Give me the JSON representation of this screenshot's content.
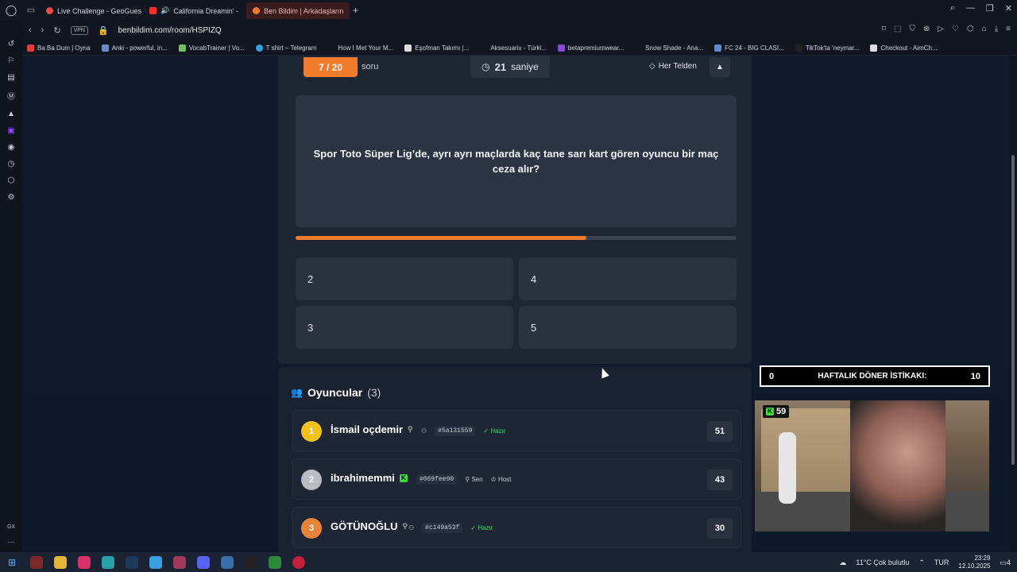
{
  "browser": {
    "tabs": [
      {
        "title": "Live Challenge - GeoGues",
        "color": "#e94a4a"
      },
      {
        "title": "California Dreamin' -",
        "color": "#ff2f2f"
      },
      {
        "title": "Ben Bildim | Arkadaşların",
        "color": "#f07b2a"
      }
    ],
    "url": "benbildim.com/room/HSPIZQ",
    "vpn_label": "VPN"
  },
  "bookmarks": [
    {
      "label": "Ba Ba Dum | Oyna",
      "color": "#e23b3b"
    },
    {
      "label": "Anki - powerful, in...",
      "color": "#6d8cc7"
    },
    {
      "label": "VocabTrainer | Vo...",
      "color": "#6ec05a"
    },
    {
      "label": "T shirt – Telegram",
      "color": "#3aa0e0"
    },
    {
      "label": "How I Met Your M...",
      "color": "#121620"
    },
    {
      "label": "Eşofman Takımı |...",
      "color": "#dddddd"
    },
    {
      "label": "Aksesuarix - Türki...",
      "color": "#121620"
    },
    {
      "label": "betapremiumwear...",
      "color": "#8a4ad8"
    },
    {
      "label": "Snow Shade - Ana...",
      "color": "#121620"
    },
    {
      "label": "FC 24 - BIG CLASI...",
      "color": "#5a8ad0"
    },
    {
      "label": "TikTok'ta 'neymar...",
      "color": "#222222"
    },
    {
      "label": "Checkout - AimCh...",
      "color": "#dddddd"
    }
  ],
  "quiz": {
    "question_counter": "7 / 20",
    "question_unit": "soru",
    "timer_value": "21",
    "timer_unit": "saniye",
    "category": "Her Telden",
    "question_text": "Spor Toto Süper Lig’de, ayrı ayrı maçlarda kaç tane sarı kart gören oyuncu bir maç ceza alır?",
    "progress_fraction": 0.66,
    "answers": [
      "2",
      "4",
      "3",
      "5"
    ]
  },
  "players_section": {
    "title": "Oyuncular",
    "count": "(3)",
    "players": [
      {
        "rank": "1",
        "name": "İsmail oçdemir",
        "tag": "#5a131559",
        "status": "Hazır",
        "score": "51",
        "rank_color": "#f2c21b"
      },
      {
        "rank": "2",
        "name": "ibrahimemmi",
        "tag": "#069fee90",
        "you": "Sen",
        "host": "Host",
        "score": "43",
        "rank_color": "#b9bcc2"
      },
      {
        "rank": "3",
        "name": "GÖTÜNOĞLU",
        "tag": "#c149a53f",
        "status": "Hazır",
        "score": "30",
        "rank_color": "#e8843a"
      }
    ]
  },
  "overlay": {
    "left_value": "0",
    "title": "HAFTALIK DÖNER İSTİKAKI:",
    "right_value": "10",
    "cam_badge": "59"
  },
  "taskbar": {
    "weather": "11°C  Çok bulutlu",
    "lang": "TUR",
    "time": "23:29",
    "date": "12.10.2025",
    "notif_count": "4"
  }
}
